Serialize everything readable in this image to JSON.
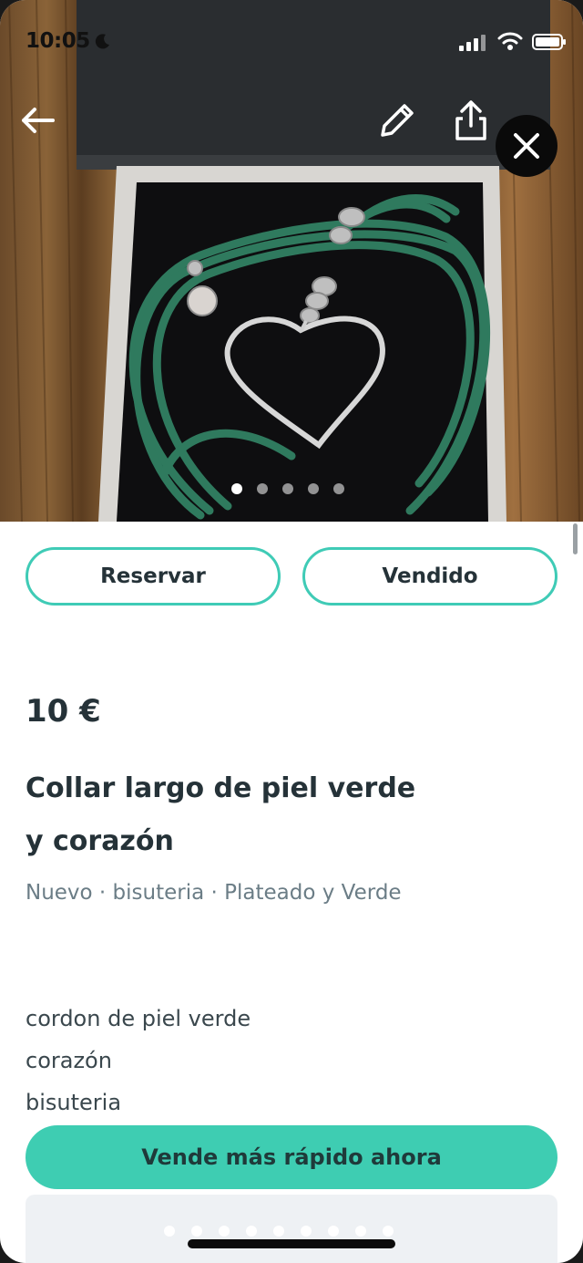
{
  "status_bar": {
    "time": "10:05",
    "icons": [
      "moon-icon",
      "signal-icon",
      "wifi-icon",
      "battery-icon"
    ]
  },
  "top_nav": {
    "icons": [
      "arrow-left-icon",
      "pencil-icon",
      "share-icon",
      "close-icon"
    ]
  },
  "gallery": {
    "image_count": 5,
    "active_index": 0
  },
  "actions": {
    "reserve_label": "Reservar",
    "sold_label": "Vendido"
  },
  "product": {
    "price": "10 €",
    "title_line1": "Collar largo de piel verde",
    "title_line2": "y corazón",
    "meta": "Nuevo · bisuteria · Plateado y Verde",
    "description_lines": [
      "cordon de piel verde",
      "corazón",
      "bisuteria"
    ]
  },
  "cta": {
    "label": "Vende más rápido ahora"
  },
  "colors": {
    "accent": "#3ecdb2",
    "text_dark": "#253238",
    "text_muted": "#6b7d86"
  }
}
